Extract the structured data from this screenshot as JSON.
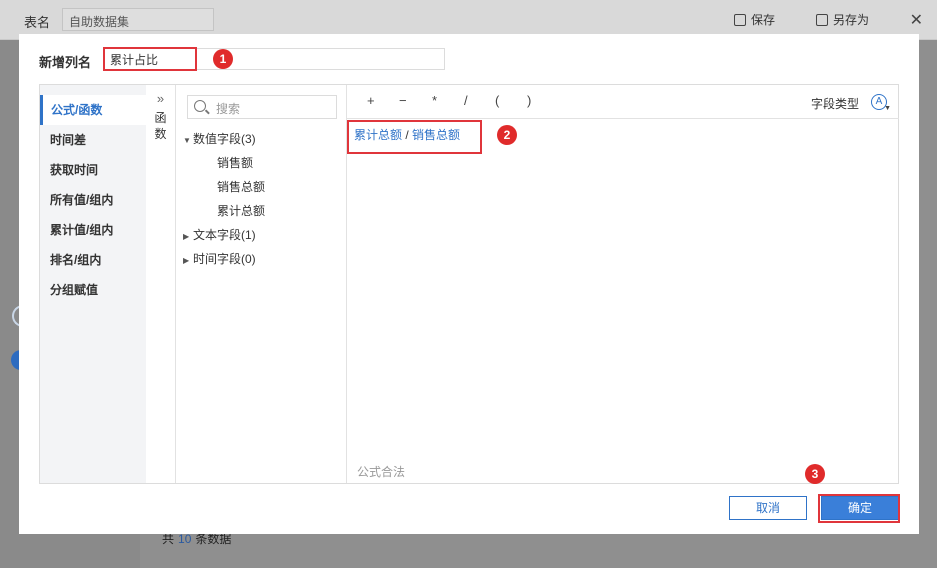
{
  "background": {
    "table_name_label": "表名",
    "table_name_value": "自助数据集",
    "save_label": "保存",
    "save_as_label": "另存为",
    "close_icon": "close-icon",
    "footer_prefix": "共",
    "footer_count": "10",
    "footer_suffix": "条数据"
  },
  "dialog": {
    "column_name_label": "新增列名",
    "column_name_value": "累计占比",
    "categories": [
      {
        "label": "公式/函数",
        "active": true
      },
      {
        "label": "时间差"
      },
      {
        "label": "获取时间"
      },
      {
        "label": "所有值/组内"
      },
      {
        "label": "累计值/组内"
      },
      {
        "label": "排名/组内"
      },
      {
        "label": "分组赋值"
      }
    ],
    "function_tab": {
      "chevron": "»",
      "line1": "函",
      "line2": "数"
    },
    "search_placeholder": "搜索",
    "tree": {
      "numeric_group": "数值字段(3)",
      "numeric_fields": [
        "销售额",
        "销售总额",
        "累计总额"
      ],
      "text_group": "文本字段(1)",
      "time_group": "时间字段(0)"
    },
    "operators": [
      "+",
      "−",
      "*",
      "/",
      "(",
      ")"
    ],
    "field_type_label": "字段类型",
    "field_type_icon": "A",
    "formula": {
      "field1": "累计总额",
      "op": " / ",
      "field2": "销售总额"
    },
    "formula_status": "公式合法",
    "cancel_label": "取消",
    "confirm_label": "确定"
  },
  "annotations": {
    "badge1": "1",
    "badge2": "2",
    "badge3": "3"
  },
  "colors": {
    "accent": "#2f73c8",
    "annotation_red": "#e0353b"
  }
}
